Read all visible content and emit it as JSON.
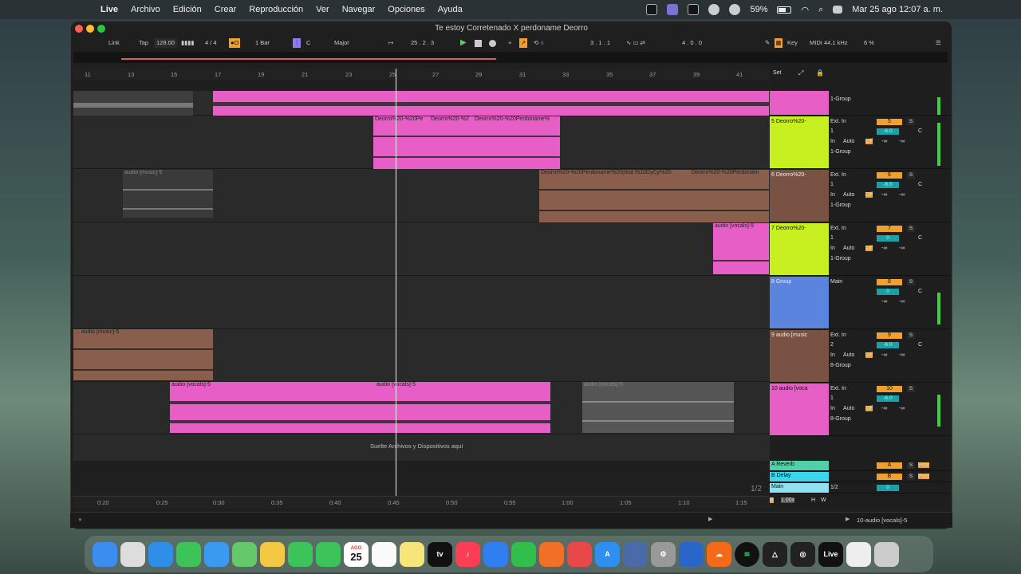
{
  "menubar": {
    "app": "Live",
    "items": [
      "Archivo",
      "Edición",
      "Crear",
      "Reproducción",
      "Ver",
      "Navegar",
      "Opciones",
      "Ayuda"
    ],
    "battery": "59%",
    "datetime": "Mar 25 ago  12:07 a. m."
  },
  "window": {
    "title": "Te estoy Corretenado X perdoname Deorro"
  },
  "control": {
    "link": "Link",
    "tap": "Tap",
    "tempo": "128.00",
    "meter": "4 / 4",
    "metronome": "●O",
    "quantize": "1 Bar",
    "key": "C",
    "scale": "Major",
    "position": "25 .  2 .  3",
    "loop_start": "3 .  1 .  1",
    "loop_len": "4 .  0 .  0",
    "key_map": "Key",
    "midi": "MIDI",
    "sample_rate": "44.1 kHz",
    "cpu": "6 %"
  },
  "ruler": {
    "ticks": [
      "11",
      "13",
      "15",
      "17",
      "19",
      "21",
      "23",
      "25",
      "27",
      "29",
      "31",
      "33",
      "35",
      "37",
      "39",
      "41"
    ],
    "set": "Set"
  },
  "tracks": [
    {
      "name": "",
      "clips": []
    },
    {
      "name": "5 Deorro%20-",
      "input": "Ext. In",
      "chan": "1",
      "route": "1-Group",
      "num": "5",
      "vol": "-6.0",
      "pan": "C",
      "clips": [
        "Deorro%20-%20Pe",
        "Deorro%20-%2",
        "Deorro%20-%20Perdoname%"
      ]
    },
    {
      "name": "6 Deorro%20-",
      "input": "Ext. In",
      "chan": "1",
      "route": "1-Group",
      "num": "6",
      "vol": "-6.0",
      "pan": "C",
      "clips": [
        "audio [music]-5",
        "Deorro%20-%20Perdoname%20(feat.%20DyCy%20",
        "Deorro%20-%20Perdonam"
      ]
    },
    {
      "name": "7 Deorro%20-",
      "input": "Ext. In",
      "chan": "1",
      "route": "1-Group",
      "num": "7",
      "vol": "0",
      "pan": "C",
      "clips": [
        "audio [vocals]-5"
      ]
    },
    {
      "name": "8 Group",
      "input": "Main",
      "num": "8",
      "vol": "0",
      "pan": "C",
      "clips": []
    },
    {
      "name": "9 audio [music",
      "input": "Ext. In",
      "chan": "2",
      "route": "8-Group",
      "num": "9",
      "vol": "-6.0",
      "pan": "C",
      "clips": [
        "... audio [music]-5"
      ]
    },
    {
      "name": "10 audio [voca",
      "input": "Ext. In",
      "chan": "1",
      "route": "8-Group",
      "num": "10",
      "vol": "-6.0",
      "pan": "C",
      "clips": [
        "audio [vocals]-5",
        "audio [vocals]-5",
        "audio [vocals]-5"
      ]
    }
  ],
  "group_top": {
    "route": "1-Group"
  },
  "labels": {
    "in": "In",
    "auto": "Auto",
    "off": "Off",
    "s": "S",
    "inf": "-∞",
    "drop": "Suelte Archivos y Dispositivos aquí",
    "post": "Post",
    "ratio": "1/2",
    "zoom": "1.00x",
    "h": "H",
    "w": "W",
    "b": "B",
    "page": "1/2"
  },
  "returns": [
    {
      "name": "A Reverb",
      "letter": "A"
    },
    {
      "name": "B Delay",
      "letter": "B"
    },
    {
      "name": "Main",
      "route": "1/2"
    }
  ],
  "time_ticks": [
    "0:20",
    "0:25",
    "0:30",
    "0:35",
    "0:40",
    "0:45",
    "0:50",
    "0:55",
    "1:00",
    "1:05",
    "1:10",
    "1:15"
  ],
  "bottom": {
    "selected": "10-audio [vocals]-5"
  },
  "dock": [
    "Finder",
    "Launchpad",
    "Safari",
    "Messages",
    "Mail",
    "Maps",
    "Photos",
    "FaceTime",
    "Phone",
    "Calendar",
    "Reminders",
    "Notes",
    "TV",
    "Music",
    "Keynote",
    "Numbers",
    "Pages",
    "Rocket",
    "App Store",
    "Simulator",
    "Settings",
    "Audio",
    "SoundCloud",
    "Spotify",
    "Triangle",
    "Camera",
    "Live",
    "Files",
    "Trash"
  ],
  "dock_date": "25",
  "dock_month": "AGO"
}
